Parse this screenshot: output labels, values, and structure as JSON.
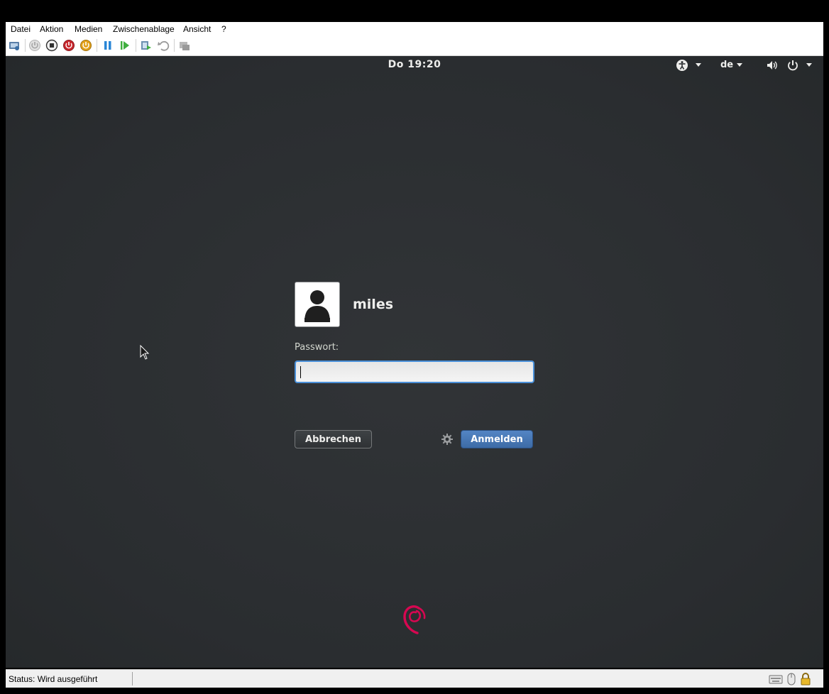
{
  "menu": [
    "Datei",
    "Aktion",
    "Medien",
    "Zwischenablage",
    "Ansicht",
    "?"
  ],
  "toolbar": {
    "icons": [
      "ctrl-alt-del-icon",
      "start-icon",
      "turn-off-icon",
      "shutdown-icon",
      "save-state-icon",
      "pause-icon",
      "resume-icon",
      "checkpoint-icon",
      "revert-icon",
      "enhanced-session-icon"
    ]
  },
  "gnome_panel": {
    "clock": "Do 19:20",
    "language": "de",
    "icons": [
      "accessibility-icon",
      "volume-icon",
      "power-icon"
    ]
  },
  "login": {
    "username": "miles",
    "password_label": "Passwort:",
    "password_value": "",
    "cancel_label": "Abbrechen",
    "signin_label": "Anmelden"
  },
  "statusbar": {
    "status": "Status: Wird ausgeführt"
  },
  "colors": {
    "screen_bg": "#2b2e31",
    "accent_blue": "#4a90d9",
    "debian_red": "#d70751"
  }
}
